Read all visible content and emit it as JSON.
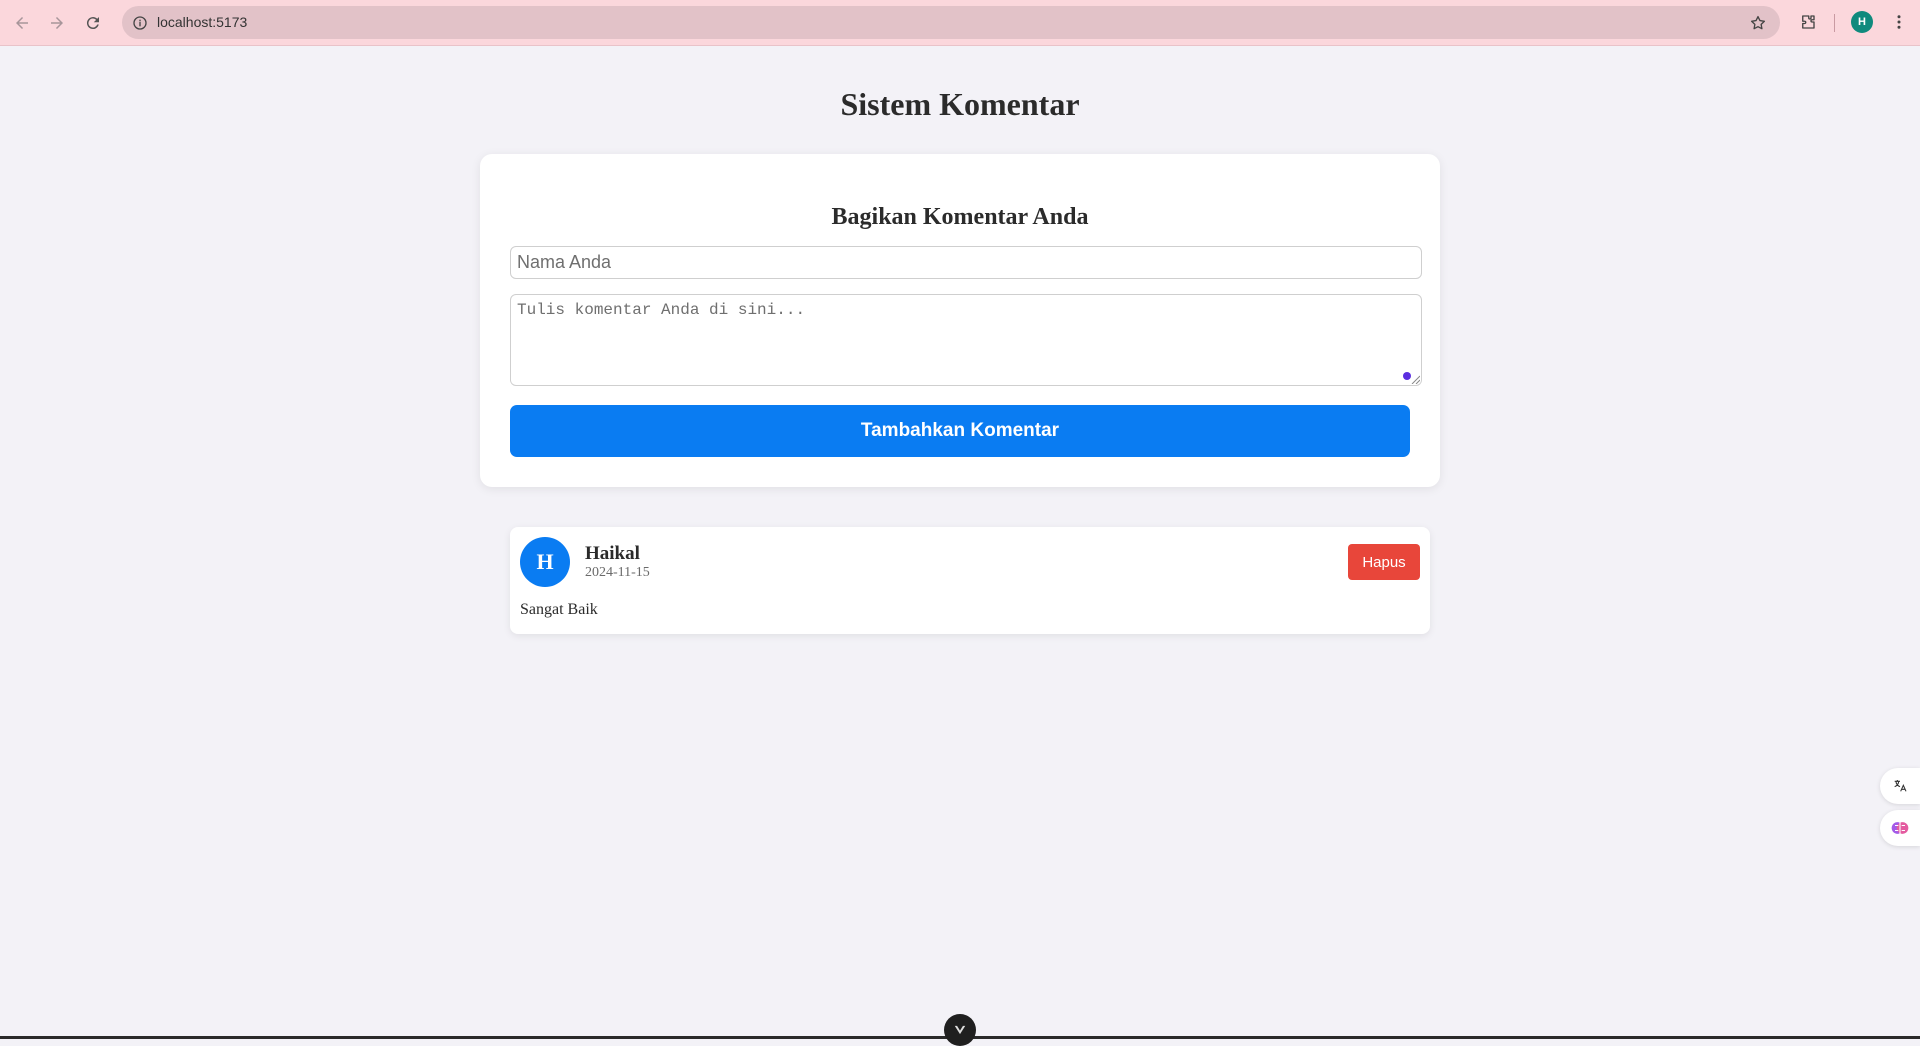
{
  "browser": {
    "url": "localhost:5173",
    "profile_initial": "H"
  },
  "page": {
    "title": "Sistem Komentar"
  },
  "form": {
    "title": "Bagikan Komentar Anda",
    "name_placeholder": "Nama Anda",
    "name_value": "",
    "comment_placeholder": "Tulis komentar Anda di sini...",
    "comment_value": "",
    "submit_label": "Tambahkan Komentar"
  },
  "comments": [
    {
      "initial": "H",
      "author": "Haikal",
      "date": "2024-11-15",
      "text": "Sangat Baik",
      "delete_label": "Hapus"
    }
  ],
  "colors": {
    "accent": "#0a7cf2",
    "danger": "#e8463a",
    "chrome": "#fbd7dc",
    "page_bg": "#f3f2f7"
  },
  "icons": {
    "back": "arrow-left-icon",
    "forward": "arrow-right-icon",
    "reload": "reload-icon",
    "site_info": "info-icon",
    "bookmark": "star-icon",
    "extensions": "puzzle-icon",
    "menu": "kebab-menu-icon",
    "translate": "translate-icon",
    "brain": "brain-icon",
    "devtools": "vue-icon"
  }
}
